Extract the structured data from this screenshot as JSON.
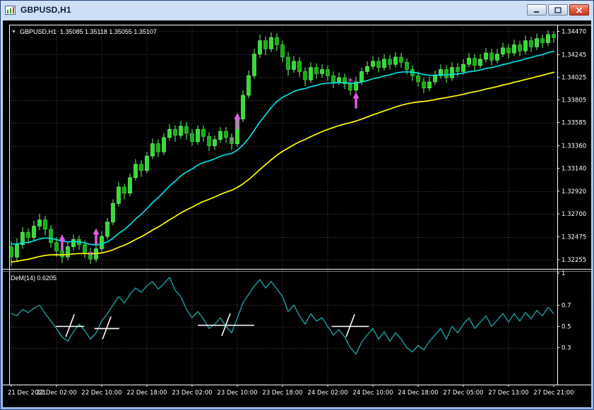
{
  "window": {
    "title": "GBPUSD,H1"
  },
  "header": {
    "symbol": "GBPUSD,H1",
    "ohlc": "1.35085 1.35118 1.35055 1.35107"
  },
  "indicator": {
    "label": "DeM(14) 0.6205"
  },
  "colors": {
    "bull": "#30e030",
    "bear": "#12b212",
    "bull_edge": "#86ff86",
    "bear_edge": "#4ae04a",
    "wick": "#6fff6f",
    "signal": "#e45ce4",
    "dem": "#1d9e9e",
    "grid": "#474747",
    "frame": "#ffffff",
    "text": "#ffffff"
  },
  "chart_data": [
    {
      "type": "candlestick",
      "symbol": "GBPUSD",
      "timeframe": "H1",
      "ylim": [
        1.32165,
        1.34535
      ],
      "y_ticks": [
        "1.34470",
        "1.34245",
        "1.34025",
        "1.33805",
        "1.33585",
        "1.33360",
        "1.33140",
        "1.32920",
        "1.32700",
        "1.32475",
        "1.32255"
      ],
      "x_labels": [
        "21 Dec 2021",
        "22 Dec 02:00",
        "22 Dec 10:00",
        "22 Dec 18:00",
        "23 Dec 02:00",
        "23 Dec 10:00",
        "23 Dec 18:00",
        "24 Dec 02:00",
        "24 Dec 10:00",
        "24 Dec 18:00",
        "27 Dec 05:00",
        "27 Dec 13:00",
        "27 Dec 21:00"
      ],
      "candles": [
        [
          1.3238,
          1.3243,
          1.3219,
          1.3228
        ],
        [
          1.3228,
          1.3246,
          1.3224,
          1.324
        ],
        [
          1.324,
          1.3257,
          1.3236,
          1.3252
        ],
        [
          1.3252,
          1.3256,
          1.3241,
          1.3247
        ],
        [
          1.3247,
          1.3263,
          1.3244,
          1.3258
        ],
        [
          1.3258,
          1.327,
          1.3254,
          1.3264
        ],
        [
          1.3264,
          1.3268,
          1.3249,
          1.3255
        ],
        [
          1.3255,
          1.3259,
          1.3237,
          1.3242
        ],
        [
          1.3242,
          1.3247,
          1.3228,
          1.3234
        ],
        [
          1.3234,
          1.324,
          1.3222,
          1.3228
        ],
        [
          1.3228,
          1.3243,
          1.3225,
          1.3238
        ],
        [
          1.3238,
          1.325,
          1.3234,
          1.3245
        ],
        [
          1.3245,
          1.3249,
          1.3235,
          1.324
        ],
        [
          1.324,
          1.3244,
          1.3227,
          1.3232
        ],
        [
          1.3232,
          1.3237,
          1.3221,
          1.3226
        ],
        [
          1.3226,
          1.3241,
          1.3223,
          1.3236
        ],
        [
          1.3236,
          1.3253,
          1.3233,
          1.3248
        ],
        [
          1.3248,
          1.3266,
          1.3245,
          1.3262
        ],
        [
          1.3262,
          1.3284,
          1.3259,
          1.328
        ],
        [
          1.328,
          1.3301,
          1.3277,
          1.3296
        ],
        [
          1.3296,
          1.3299,
          1.3284,
          1.329
        ],
        [
          1.329,
          1.3309,
          1.3287,
          1.3305
        ],
        [
          1.3305,
          1.3323,
          1.3302,
          1.3318
        ],
        [
          1.3318,
          1.3322,
          1.3306,
          1.3312
        ],
        [
          1.3312,
          1.333,
          1.3309,
          1.3326
        ],
        [
          1.3326,
          1.3343,
          1.3323,
          1.3338
        ],
        [
          1.3338,
          1.3342,
          1.3325,
          1.333
        ],
        [
          1.333,
          1.3348,
          1.3327,
          1.3344
        ],
        [
          1.3344,
          1.3357,
          1.3341,
          1.3352
        ],
        [
          1.3352,
          1.3356,
          1.334,
          1.3346
        ],
        [
          1.3346,
          1.336,
          1.3343,
          1.3355
        ],
        [
          1.3355,
          1.3359,
          1.3342,
          1.3348
        ],
        [
          1.3348,
          1.3352,
          1.3336,
          1.334
        ],
        [
          1.334,
          1.3356,
          1.3337,
          1.3352
        ],
        [
          1.3352,
          1.3356,
          1.334,
          1.3345
        ],
        [
          1.3345,
          1.3349,
          1.3331,
          1.3336
        ],
        [
          1.3336,
          1.3346,
          1.3332,
          1.3342
        ],
        [
          1.3342,
          1.3354,
          1.3339,
          1.335
        ],
        [
          1.335,
          1.3354,
          1.3339,
          1.3344
        ],
        [
          1.3344,
          1.3348,
          1.3332,
          1.3338
        ],
        [
          1.3338,
          1.3366,
          1.3335,
          1.3362
        ],
        [
          1.3362,
          1.339,
          1.3359,
          1.3385
        ],
        [
          1.3385,
          1.3409,
          1.3382,
          1.3404
        ],
        [
          1.3404,
          1.343,
          1.3401,
          1.3425
        ],
        [
          1.3425,
          1.3444,
          1.3421,
          1.3438
        ],
        [
          1.3438,
          1.3442,
          1.3424,
          1.343
        ],
        [
          1.343,
          1.3446,
          1.3427,
          1.3441
        ],
        [
          1.3441,
          1.3445,
          1.3428,
          1.3434
        ],
        [
          1.3434,
          1.3438,
          1.3417,
          1.3422
        ],
        [
          1.3422,
          1.3427,
          1.3404,
          1.341
        ],
        [
          1.341,
          1.3423,
          1.3407,
          1.3418
        ],
        [
          1.3418,
          1.3422,
          1.3403,
          1.3408
        ],
        [
          1.3408,
          1.3412,
          1.3394,
          1.34
        ],
        [
          1.34,
          1.3417,
          1.3397,
          1.3412
        ],
        [
          1.3412,
          1.3416,
          1.3401,
          1.3406
        ],
        [
          1.3406,
          1.3415,
          1.3402,
          1.341
        ],
        [
          1.341,
          1.3414,
          1.3399,
          1.3404
        ],
        [
          1.3404,
          1.3408,
          1.3392,
          1.3398
        ],
        [
          1.3398,
          1.3407,
          1.3395,
          1.3402
        ],
        [
          1.3402,
          1.3406,
          1.3391,
          1.3396
        ],
        [
          1.3396,
          1.34,
          1.3385,
          1.339
        ],
        [
          1.339,
          1.3403,
          1.3387,
          1.3398
        ],
        [
          1.3398,
          1.3412,
          1.3395,
          1.3408
        ],
        [
          1.3408,
          1.3418,
          1.3405,
          1.3413
        ],
        [
          1.3413,
          1.3423,
          1.341,
          1.3418
        ],
        [
          1.3418,
          1.3422,
          1.3407,
          1.3412
        ],
        [
          1.3412,
          1.3425,
          1.3409,
          1.342
        ],
        [
          1.342,
          1.3424,
          1.341,
          1.3415
        ],
        [
          1.3415,
          1.3427,
          1.3412,
          1.3422
        ],
        [
          1.3422,
          1.3426,
          1.3412,
          1.3417
        ],
        [
          1.3417,
          1.3421,
          1.3405,
          1.341
        ],
        [
          1.341,
          1.3414,
          1.3399,
          1.3404
        ],
        [
          1.3404,
          1.3408,
          1.3393,
          1.3398
        ],
        [
          1.3398,
          1.3402,
          1.3387,
          1.3392
        ],
        [
          1.3392,
          1.3403,
          1.3389,
          1.3398
        ],
        [
          1.3398,
          1.3409,
          1.3395,
          1.3404
        ],
        [
          1.3404,
          1.3415,
          1.3401,
          1.341
        ],
        [
          1.341,
          1.3414,
          1.3397,
          1.3402
        ],
        [
          1.3402,
          1.3417,
          1.3399,
          1.3412
        ],
        [
          1.3412,
          1.3416,
          1.3403,
          1.3408
        ],
        [
          1.3408,
          1.342,
          1.3405,
          1.3415
        ],
        [
          1.3415,
          1.3426,
          1.3412,
          1.3421
        ],
        [
          1.3421,
          1.3425,
          1.3409,
          1.3414
        ],
        [
          1.3414,
          1.3425,
          1.3411,
          1.342
        ],
        [
          1.342,
          1.3431,
          1.3417,
          1.3426
        ],
        [
          1.3426,
          1.343,
          1.3414,
          1.3419
        ],
        [
          1.3419,
          1.343,
          1.3416,
          1.3425
        ],
        [
          1.3425,
          1.3436,
          1.3422,
          1.3431
        ],
        [
          1.3431,
          1.3435,
          1.3421,
          1.3426
        ],
        [
          1.3426,
          1.3439,
          1.3423,
          1.3434
        ],
        [
          1.3434,
          1.3438,
          1.3423,
          1.3428
        ],
        [
          1.3428,
          1.3443,
          1.3425,
          1.3438
        ],
        [
          1.3438,
          1.3442,
          1.3427,
          1.3432
        ],
        [
          1.3432,
          1.3445,
          1.3429,
          1.344
        ],
        [
          1.344,
          1.3444,
          1.3431,
          1.3436
        ],
        [
          1.3436,
          1.3448,
          1.3433,
          1.3444
        ],
        [
          1.3444,
          1.3447,
          1.3436,
          1.3441
        ]
      ],
      "overlays": [
        {
          "name": "ma-fast",
          "period": 20,
          "seed": 1.3242,
          "color": "#00e0e0",
          "width": 1.7
        },
        {
          "name": "ma-slow",
          "period": 50,
          "seed": 1.3223,
          "color": "#ffff00",
          "width": 1.7
        }
      ],
      "arrows": [
        {
          "i": 9,
          "p": 1.325
        },
        {
          "i": 15,
          "p": 1.3256
        },
        {
          "i": 40,
          "p": 1.3368
        },
        {
          "i": 61,
          "p": 1.3388
        }
      ],
      "stars": [
        {
          "i": 14,
          "p": 1.323
        },
        {
          "i": 39,
          "p": 1.334
        },
        {
          "i": 60,
          "p": 1.3398
        }
      ]
    },
    {
      "type": "line",
      "name": "DeM(14)",
      "current_value": "0.6205",
      "ylim": [
        0,
        1
      ],
      "y_ticks": [
        "1",
        "0.7",
        "0.5",
        "0.3"
      ],
      "values": [
        0.62,
        0.6,
        0.66,
        0.63,
        0.67,
        0.7,
        0.62,
        0.55,
        0.48,
        0.4,
        0.36,
        0.45,
        0.52,
        0.46,
        0.38,
        0.44,
        0.55,
        0.62,
        0.7,
        0.78,
        0.72,
        0.8,
        0.86,
        0.82,
        0.88,
        0.92,
        0.85,
        0.9,
        0.96,
        0.84,
        0.78,
        0.66,
        0.58,
        0.64,
        0.57,
        0.48,
        0.52,
        0.58,
        0.5,
        0.44,
        0.58,
        0.72,
        0.8,
        0.88,
        0.94,
        0.86,
        0.92,
        0.85,
        0.78,
        0.64,
        0.7,
        0.6,
        0.52,
        0.62,
        0.55,
        0.58,
        0.5,
        0.42,
        0.47,
        0.4,
        0.3,
        0.24,
        0.35,
        0.42,
        0.48,
        0.38,
        0.45,
        0.36,
        0.44,
        0.38,
        0.3,
        0.26,
        0.32,
        0.28,
        0.36,
        0.42,
        0.48,
        0.38,
        0.5,
        0.44,
        0.52,
        0.58,
        0.48,
        0.54,
        0.6,
        0.5,
        0.56,
        0.62,
        0.54,
        0.62,
        0.55,
        0.63,
        0.57,
        0.65,
        0.6,
        0.68,
        0.62
      ],
      "marks": [
        {
          "i": 10.4,
          "level": 0.5,
          "half": 2.5
        },
        {
          "i": 16.9,
          "level": 0.48,
          "half": 2.2
        },
        {
          "i": 38.0,
          "level": 0.51,
          "half": 5.0
        },
        {
          "i": 60.0,
          "level": 0.5,
          "half": 3.3
        }
      ]
    }
  ]
}
